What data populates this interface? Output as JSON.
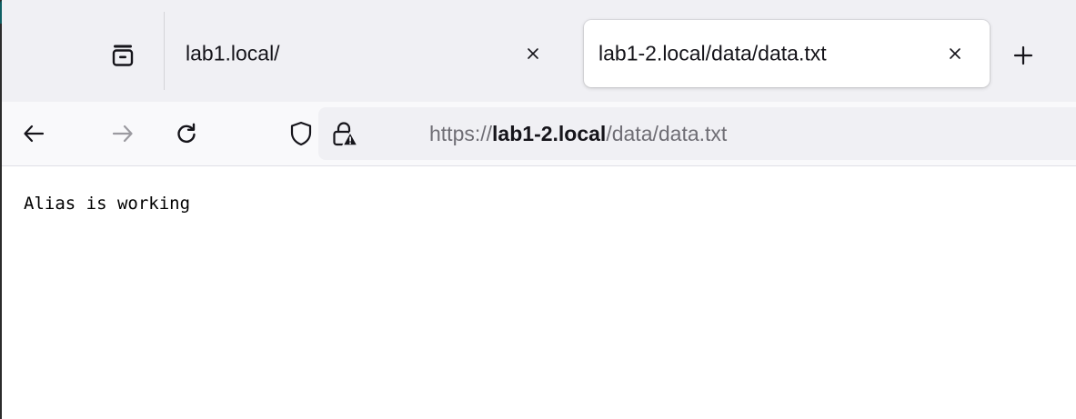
{
  "tabs": [
    {
      "title": "lab1.local/",
      "active": false,
      "close": "×"
    },
    {
      "title": "lab1-2.local/data/data.txt",
      "active": true,
      "close": "×"
    }
  ],
  "new_tab_label": "+",
  "icons": {
    "tab_list": "tab-list-icon",
    "back": "arrow-left-icon",
    "forward": "arrow-right-icon",
    "reload": "reload-icon",
    "tracking": "shield-icon",
    "connection": "lock-warning-icon"
  },
  "urlbar": {
    "scheme": "https://",
    "host": "lab1-2.local",
    "path": "/data/data.txt"
  },
  "page": {
    "text": "Alias is working"
  },
  "colors": {
    "accent_edge": "#0f5f63",
    "toolbar": "#f9f9fb",
    "tabstrip": "#f0f0f4",
    "text": "#15141a",
    "muted": "#6f6e75"
  }
}
